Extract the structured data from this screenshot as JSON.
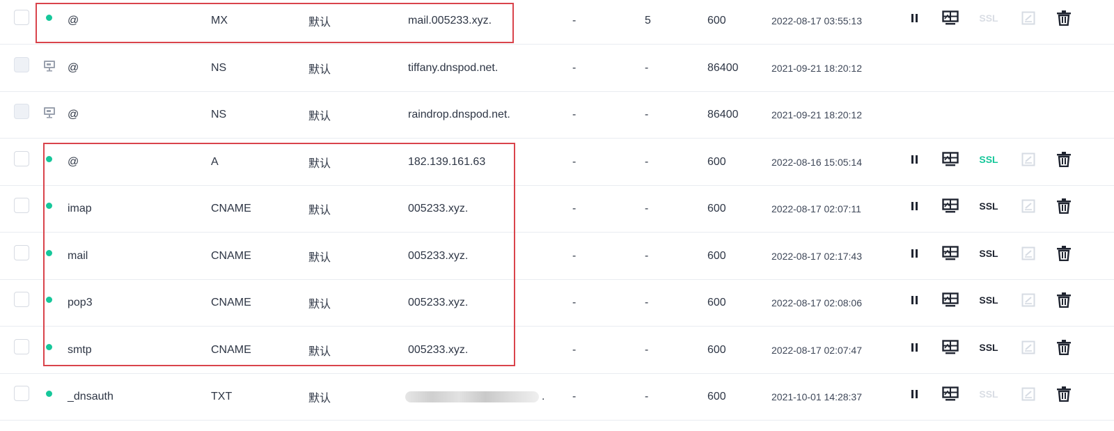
{
  "records": [
    {
      "host": "@",
      "type": "MX",
      "line": "默认",
      "value": "mail.005233.xyz.",
      "weight": "-",
      "mx": "5",
      "ttl": "600",
      "time": "2022-08-17 03:55:13",
      "status": "enabled",
      "ssl": "off"
    },
    {
      "host": "@",
      "type": "NS",
      "line": "默认",
      "value": "tiffany.dnspod.net.",
      "weight": "-",
      "mx": "-",
      "ttl": "86400",
      "time": "2021-09-21 18:20:12",
      "status": "system",
      "ssl": "none"
    },
    {
      "host": "@",
      "type": "NS",
      "line": "默认",
      "value": "raindrop.dnspod.net.",
      "weight": "-",
      "mx": "-",
      "ttl": "86400",
      "time": "2021-09-21 18:20:12",
      "status": "system",
      "ssl": "none"
    },
    {
      "host": "@",
      "type": "A",
      "line": "默认",
      "value": "182.139.161.63",
      "weight": "-",
      "mx": "-",
      "ttl": "600",
      "time": "2022-08-16 15:05:14",
      "status": "enabled",
      "ssl": "green"
    },
    {
      "host": "imap",
      "type": "CNAME",
      "line": "默认",
      "value": "005233.xyz.",
      "weight": "-",
      "mx": "-",
      "ttl": "600",
      "time": "2022-08-17 02:07:11",
      "status": "enabled",
      "ssl": "dark"
    },
    {
      "host": "mail",
      "type": "CNAME",
      "line": "默认",
      "value": "005233.xyz.",
      "weight": "-",
      "mx": "-",
      "ttl": "600",
      "time": "2022-08-17 02:17:43",
      "status": "enabled",
      "ssl": "dark"
    },
    {
      "host": "pop3",
      "type": "CNAME",
      "line": "默认",
      "value": "005233.xyz.",
      "weight": "-",
      "mx": "-",
      "ttl": "600",
      "time": "2022-08-17 02:08:06",
      "status": "enabled",
      "ssl": "dark"
    },
    {
      "host": "smtp",
      "type": "CNAME",
      "line": "默认",
      "value": "005233.xyz.",
      "weight": "-",
      "mx": "-",
      "ttl": "600",
      "time": "2022-08-17 02:07:47",
      "status": "enabled",
      "ssl": "dark"
    },
    {
      "host": "_dnsauth",
      "type": "TXT",
      "line": "默认",
      "value": ".",
      "weight": "-",
      "mx": "-",
      "ttl": "600",
      "time": "2021-10-01 14:28:37",
      "status": "enabled",
      "ssl": "off",
      "value_redacted": true
    }
  ],
  "labels": {
    "ssl": "SSL"
  },
  "colors": {
    "status_dot": "#16c79a",
    "highlight": "#d9434b",
    "ssl_green": "#16c79a",
    "ssl_dark": "#1f2430",
    "ssl_off": "#d9dde4"
  },
  "icons": {
    "pause": "pause-icon",
    "monitor": "monitor-icon",
    "edit": "edit-icon",
    "delete": "trash-icon",
    "system": "system-record-icon"
  }
}
